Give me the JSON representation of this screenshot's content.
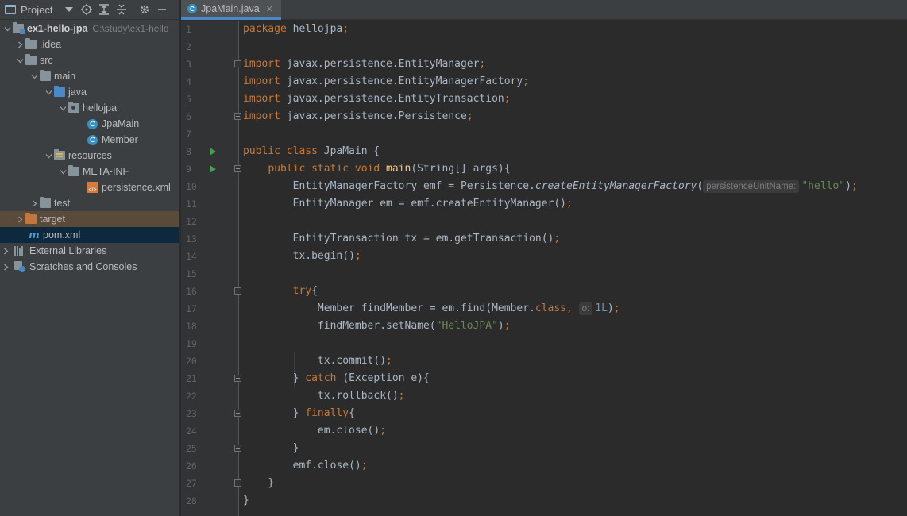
{
  "project_panel": {
    "title": "Project",
    "toolbar_icons": [
      "chevron-down-icon",
      "locate-icon",
      "expand-all-icon",
      "collapse-all-icon",
      "gear-icon",
      "minimize-icon"
    ]
  },
  "tree": {
    "root_label": "ex1-hello-jpa",
    "root_path": "C:\\study\\ex1-hello",
    "idea": ".idea",
    "src": "src",
    "main": "main",
    "java": "java",
    "hellojpa": "hellojpa",
    "jpamain": "JpaMain",
    "member": "Member",
    "resources": "resources",
    "metainf": "META-INF",
    "persistence": "persistence.xml",
    "test": "test",
    "target": "target",
    "pom": "pom.xml",
    "external": "External Libraries",
    "scratches": "Scratches and Consoles"
  },
  "editor": {
    "tab_label": "JpaMain.java",
    "line_numbers": [
      "1",
      "2",
      "3",
      "4",
      "5",
      "6",
      "7",
      "8",
      "9",
      "10",
      "11",
      "12",
      "13",
      "14",
      "15",
      "16",
      "17",
      "18",
      "19",
      "20",
      "21",
      "22",
      "23",
      "24",
      "25",
      "26",
      "27",
      "28"
    ],
    "code": {
      "l1_kw": "package",
      "l1_rest": " hellojpa",
      "semi": ";",
      "imp": "import",
      "l3": " javax.persistence.EntityManager",
      "l4": " javax.persistence.EntityManagerFactory",
      "l5": " javax.persistence.EntityTransaction",
      "l6": " javax.persistence.Persistence",
      "l8_kw": "public class",
      "l8_rest": " JpaMain {",
      "l9_kw": "public static void",
      "l9_fn": "main",
      "l9_rest": "(String[] args){",
      "l10_a": "EntityManagerFactory emf = Persistence.",
      "l10_fn": "createEntityManagerFactory",
      "l10_b": "(",
      "l10_hint": "persistenceUnitName:",
      "l10_str": "\"hello\"",
      "l10_c": ")",
      "l11": "EntityManager em = emf.createEntityManager()",
      "l13": "EntityTransaction tx = em.getTransaction()",
      "l14": "tx.begin()",
      "l16_kw": "try",
      "l16_rest": "{",
      "l17_a": "Member findMember = em.find(Member.",
      "l17_kw": "class",
      "l17_comma": ",",
      "l17_hint": "o:",
      "l17_num": "1L",
      "l17_b": ")",
      "l18_a": "findMember.setName(",
      "l18_str": "\"HelloJPA\"",
      "l18_b": ")",
      "l20": "tx.commit()",
      "l21_a": "} ",
      "l21_kw": "catch",
      "l21_b": " (Exception e){",
      "l22": "tx.rollback()",
      "l23_a": "} ",
      "l23_kw": "finally",
      "l23_b": "{",
      "l24": "em.close()",
      "l25": "}",
      "l26": "emf.close()",
      "l27": "}",
      "l28": "}"
    }
  },
  "colors": {
    "keyword": "#cc7832",
    "string": "#6a8759",
    "number": "#6897bb",
    "method_decl": "#ffc66d",
    "default_text": "#a9b7c6",
    "selection_accent": "#4a88c7"
  }
}
